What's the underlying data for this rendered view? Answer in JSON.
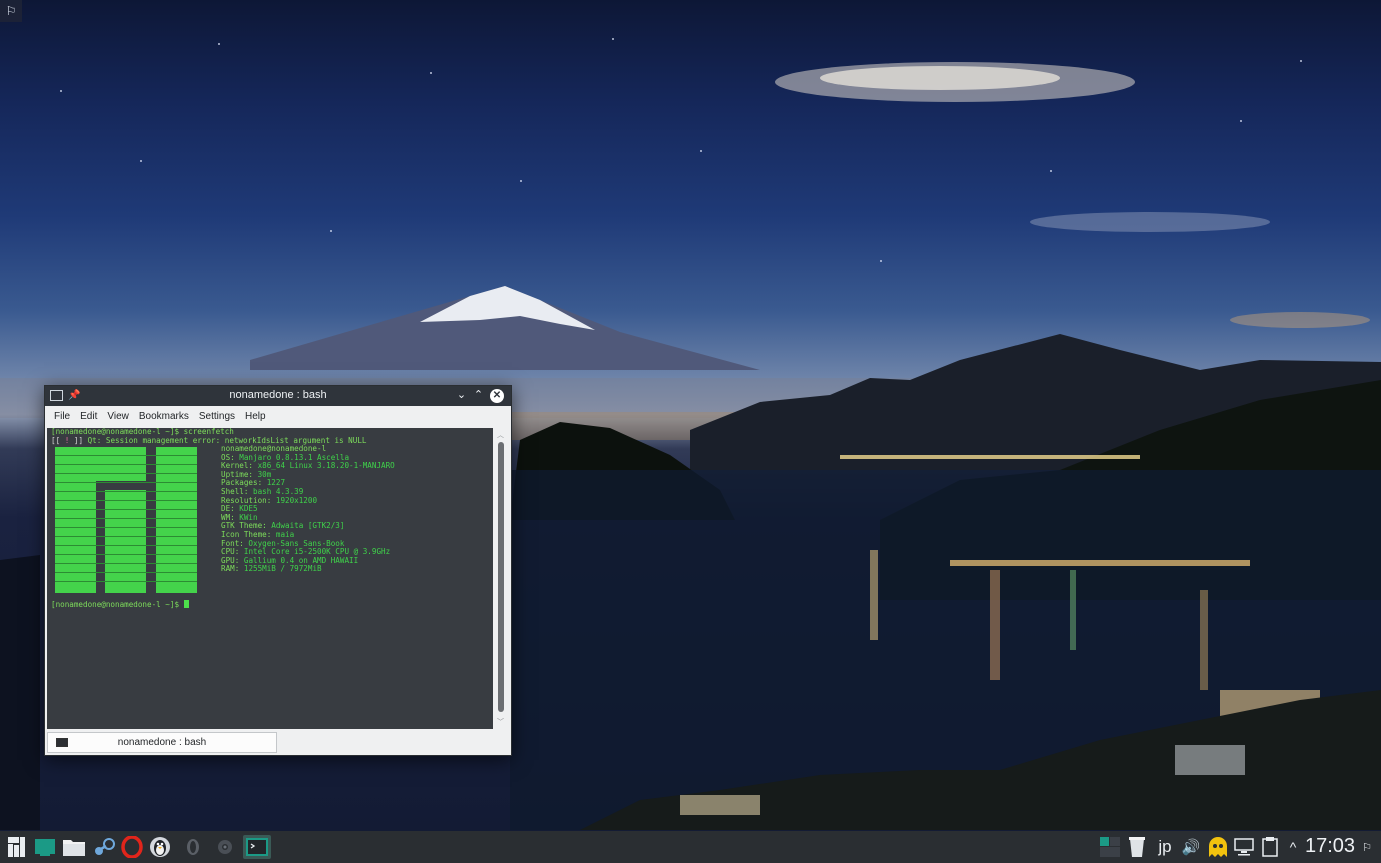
{
  "window": {
    "title": "nonamedone : bash",
    "menu": [
      "File",
      "Edit",
      "View",
      "Bookmarks",
      "Settings",
      "Help"
    ],
    "tab_label": "nonamedone : bash"
  },
  "terminal": {
    "prompt": "[nonamedone@nonamedone-l ~]$ ",
    "command": "screenfetch",
    "error_prefix": "[[ ! ]]",
    "error_text": " Qt: Session management error: networkIdsList argument is NULL",
    "user_host": "nonamedone@nonamedone-l",
    "info": [
      {
        "key": "OS:",
        "value": " Manjaro 0.8.13.1 Ascella"
      },
      {
        "key": "Kernel:",
        "value": " x86_64 Linux 3.18.20-1-MANJARO"
      },
      {
        "key": "Uptime:",
        "value": " 30m"
      },
      {
        "key": "Packages:",
        "value": " 1227"
      },
      {
        "key": "Shell:",
        "value": " bash 4.3.39"
      },
      {
        "key": "Resolution:",
        "value": " 1920x1200"
      },
      {
        "key": "DE:",
        "value": " KDE5"
      },
      {
        "key": "WM:",
        "value": " KWin"
      },
      {
        "key": "GTK Theme:",
        "value": " Adwaita [GTK2/3]"
      },
      {
        "key": "Icon Theme:",
        "value": " maia"
      },
      {
        "key": "Font:",
        "value": " Oxygen-Sans Sans-Book"
      },
      {
        "key": "CPU:",
        "value": " Intel Core i5-2500K CPU @ 3.9GHz"
      },
      {
        "key": "GPU:",
        "value": " Gallium 0.4 on AMD HAWAII"
      },
      {
        "key": "RAM:",
        "value": " 1255MiB / 7972MiB"
      }
    ]
  },
  "taskbar": {
    "launchers": [
      "application-menu-icon",
      "active-task-icon",
      "file-manager-icon",
      "steam-icon",
      "opera-icon",
      "linux-tux-icon",
      "disabled-app-icon",
      "audio-app-icon",
      "konsole-icon"
    ],
    "tray": {
      "keyboard_layout": "jp",
      "icons": [
        "pager-icon",
        "trash-icon",
        "volume-icon",
        "ghost-icon",
        "network-icon",
        "clipboard-icon",
        "expand-tray-icon"
      ]
    },
    "clock": "17:03"
  },
  "colors": {
    "terminal_bg": "#383c41",
    "terminal_fg": "#7ddc5b",
    "logo_green": "#44d34b",
    "titlebar": "#2f343b",
    "taskbar": "#2a2e32",
    "accent_teal": "#1b9a86"
  }
}
